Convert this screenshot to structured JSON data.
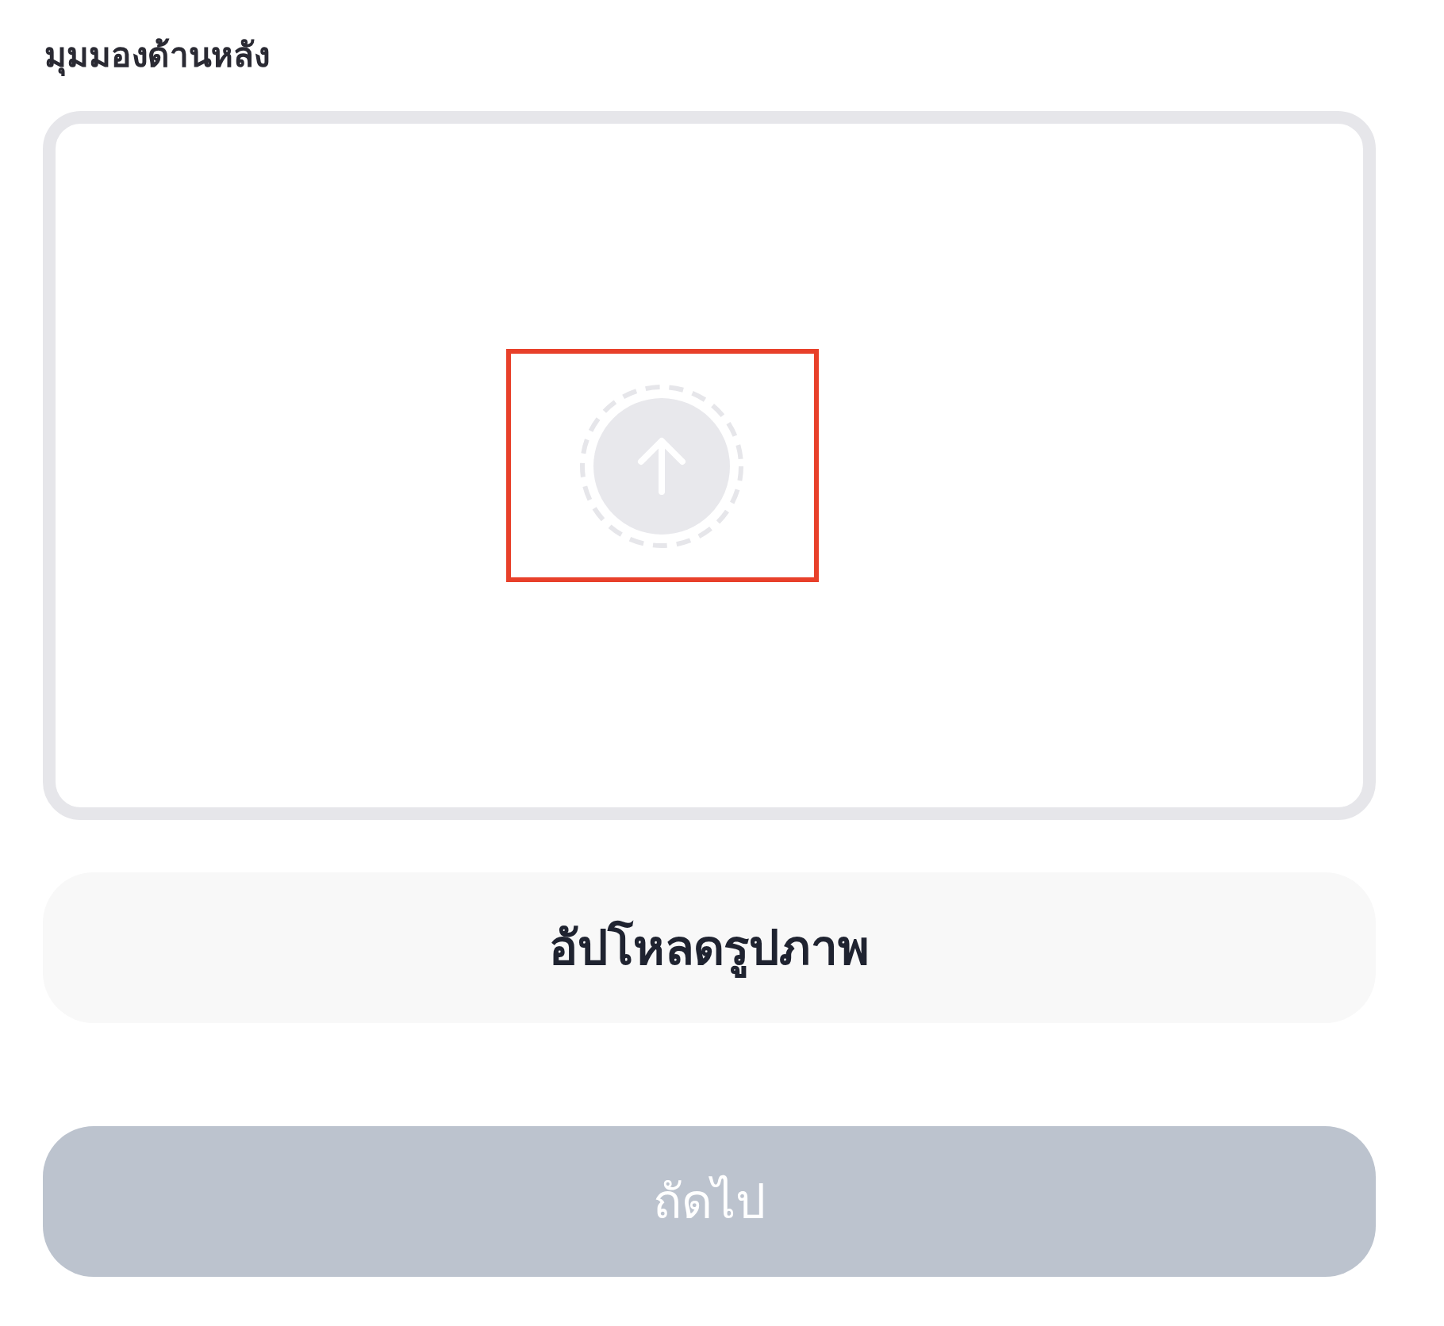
{
  "section_label": "มุมมองด้านหลัง",
  "upload_area": {
    "highlighted": true
  },
  "upload_button": {
    "label": "อัปโหลดรูปภาพ"
  },
  "next_button": {
    "label": "ถัดไป",
    "disabled": true
  }
}
